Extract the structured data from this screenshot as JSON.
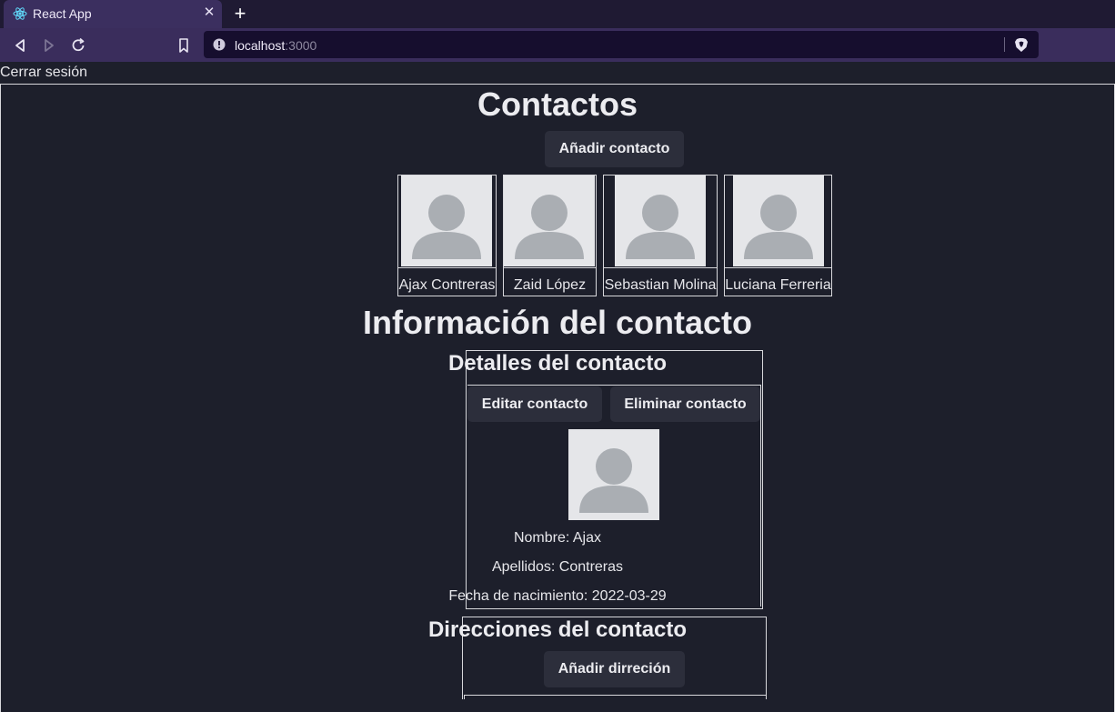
{
  "browser": {
    "tab_title": "React App",
    "url_host": "localhost",
    "url_port": ":3000"
  },
  "page": {
    "logout_label": "Cerrar sesión",
    "contacts_heading": "Contactos",
    "add_contact_label": "Añadir contacto",
    "contacts": [
      {
        "name": "Ajax Contreras"
      },
      {
        "name": "Zaid López"
      },
      {
        "name": "Sebastian Molina"
      },
      {
        "name": "Luciana Ferreria"
      }
    ],
    "info_heading": "Información del contacto",
    "details": {
      "heading": "Detalles del contacto",
      "edit_label": "Editar contacto",
      "delete_label": "Eliminar contacto",
      "name_line": "Nombre: Ajax",
      "surname_line": "Apellidos: Contreras",
      "birth_line": "Fecha de nacimiento: 2022-03-29"
    },
    "addresses": {
      "heading": "Direcciones del contacto",
      "add_label": "Añadir dirreción"
    }
  }
}
